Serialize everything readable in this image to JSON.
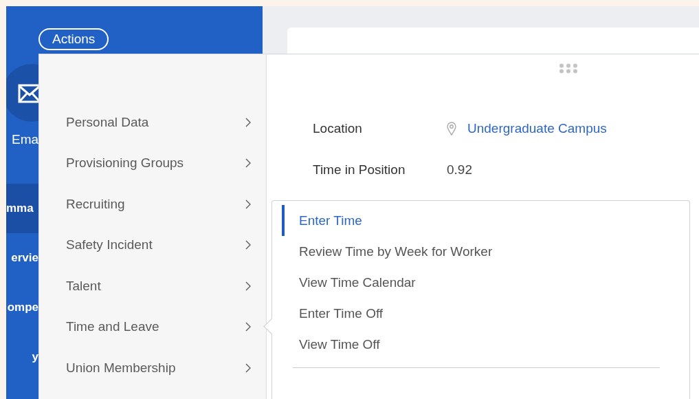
{
  "sidebar": {
    "actions_button": "Actions",
    "profile_label": "Ema",
    "nav_items": [
      {
        "label": "mma",
        "selected": true
      },
      {
        "label": "ervie",
        "selected": false
      },
      {
        "label": "ompe",
        "selected": false
      },
      {
        "label": "y",
        "selected": false
      }
    ]
  },
  "actions_menu": {
    "categories": [
      {
        "label": "Personal Data",
        "selected": false
      },
      {
        "label": "Provisioning Groups",
        "selected": false
      },
      {
        "label": "Recruiting",
        "selected": false
      },
      {
        "label": "Safety Incident",
        "selected": false
      },
      {
        "label": "Talent",
        "selected": false
      },
      {
        "label": "Time and Leave",
        "selected": true
      },
      {
        "label": "Union Membership",
        "selected": false
      }
    ],
    "details": [
      {
        "label": "Location",
        "value": "Undergraduate Campus",
        "kind": "link"
      },
      {
        "label": "Time in Position",
        "value": "0.92",
        "kind": "text"
      }
    ],
    "submenu": {
      "items": [
        {
          "label": "Enter Time",
          "selected": true
        },
        {
          "label": "Review Time by Week for Worker",
          "selected": false
        },
        {
          "label": "View Time Calendar",
          "selected": false
        },
        {
          "label": "Enter Time Off",
          "selected": false
        },
        {
          "label": "View Time Off",
          "selected": false
        }
      ]
    }
  }
}
